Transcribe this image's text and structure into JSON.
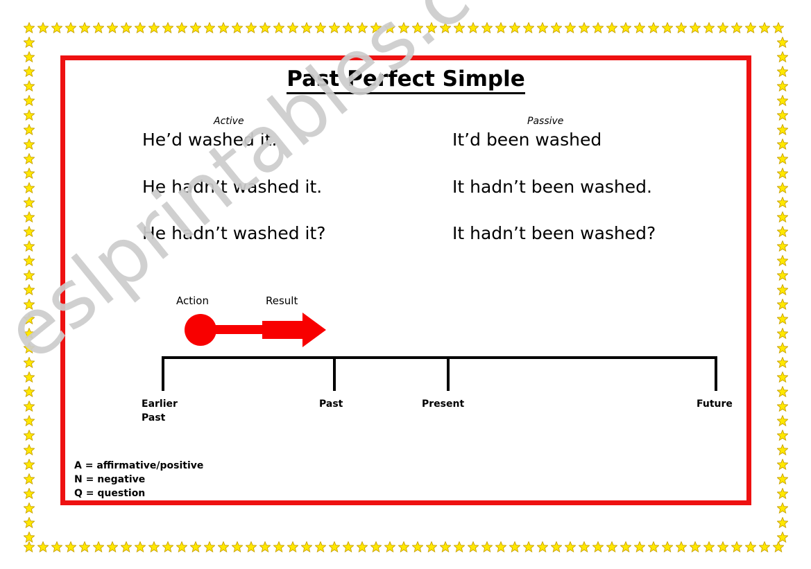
{
  "worksheet": {
    "title": "Past Perfect Simple",
    "watermark": "eslprintables.com",
    "border_color": "#ee1111",
    "star_color": "#ffe800",
    "star_outline_color": "#c8a000",
    "accent_red": "#f80000"
  },
  "columns": {
    "active_label": "Active",
    "passive_label": "Passive"
  },
  "sentences": {
    "active": {
      "affirmative": "He’d washed it.",
      "negative": "He hadn’t washed it.",
      "question": "He hadn’t washed it?"
    },
    "passive": {
      "affirmative": "It’d been washed",
      "negative": "It hadn’t been washed.",
      "question": "It hadn’t been washed?"
    }
  },
  "diagram": {
    "action_label": "Action",
    "result_label": "Result",
    "timeline": [
      {
        "id": "earlier-past",
        "label": "Earlier\nPast",
        "line1": "Earlier",
        "line2": "Past"
      },
      {
        "id": "past",
        "label": "Past",
        "line1": "Past",
        "line2": ""
      },
      {
        "id": "present",
        "label": "Present",
        "line1": "Present",
        "line2": ""
      },
      {
        "id": "future",
        "label": "Future",
        "line1": "Future",
        "line2": ""
      }
    ]
  },
  "legend": {
    "line1": "A = affirmative/positive",
    "line2": "N = negative",
    "line3": "Q = question"
  },
  "stars": {
    "top_count": 55,
    "bottom_count": 55,
    "left_count": 35,
    "right_count": 35
  }
}
